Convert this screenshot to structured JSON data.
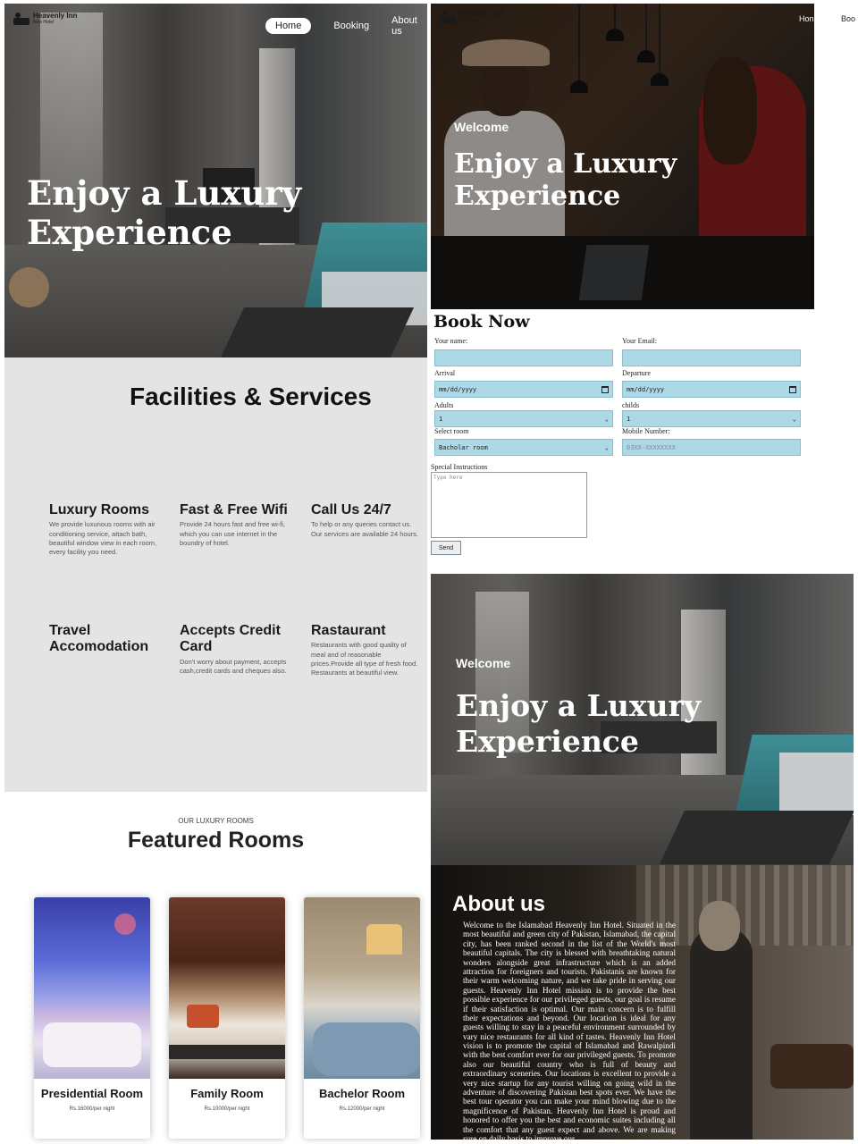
{
  "brand": {
    "name": "Heavenly Inn",
    "tagline": "Nice Hotel"
  },
  "nav": {
    "home": "Home",
    "booking": "Booking",
    "about": "About us"
  },
  "nav_right_clipped": {
    "home": "Hon",
    "booking": "Boo"
  },
  "hero": {
    "welcome": "Welcome",
    "title_line1": "Enjoy a Luxury",
    "title_line2": "Experience"
  },
  "facilities": {
    "title": "Facilities & Services",
    "items": [
      {
        "title": "Luxury Rooms",
        "text": "We provide luxurious rooms with air conditioning service, attach bath, beautiful window view in each room, every facility you need."
      },
      {
        "title": "Fast & Free Wifi",
        "text": "Provide 24 hours fast and free wi-fi, which you can use internet in the boundry of hotel."
      },
      {
        "title": "Call Us 24/7",
        "text": "To help or any queries contact us. Our services are available 24 hours."
      },
      {
        "title": "Travel Accomodation",
        "text": ""
      },
      {
        "title": "Accepts Credit Card",
        "text": "Don't worry about payment, accepts cash,credit cards and cheques also."
      },
      {
        "title": "Rastaurant",
        "text": "Restaurants with good quality of meal and of reasonable prices.Provide all type of fresh food. Restaurants at beautiful view."
      }
    ]
  },
  "featured": {
    "eyebrow": "OUR LUXURY ROOMS",
    "title": "Featured Rooms",
    "rooms": [
      {
        "name": "Presidential Room",
        "price": "Rs.16000/per night"
      },
      {
        "name": "Family Room",
        "price": "Rs.10000/per night"
      },
      {
        "name": "Bachelor Room",
        "price": "Rs.12000/per night"
      }
    ]
  },
  "booking": {
    "title": "Book Now",
    "name_label": "Your name:",
    "email_label": "Your Email:",
    "arrival_label": "Arrival",
    "arrival_value": "mm/dd/yyyy",
    "departure_label": "Departure",
    "departure_value": "mm/dd/yyyy",
    "adults_label": "Adults",
    "adults_value": "1",
    "childs_label": "childs",
    "childs_value": "1",
    "room_label": "Select room",
    "room_value": "Bacholar room",
    "mobile_label": "Mobile Number:",
    "mobile_placeholder": "03XX-XXXXXXXX",
    "instructions_label": "Special Instructions",
    "instructions_placeholder": "Type here",
    "send_label": "Send"
  },
  "about": {
    "title": "About us",
    "text": "Welcome to the Islamabad Heavenly Inn Hotel. Situated in the most beautiful and green city of Pakistan, Islamabad, the capital city, has been ranked second in the list of the World's most beautiful capitals. The city is blessed with breathtaking natural wonders alongside great infrastructure which is an added attraction for foreigners and tourists. Pakistanis are known for their warm welcoming nature, and we take pride in serving our guests. Heavenly Inn Hotel mission is to provide the best possible experience for our privileged guests, our goal is resume if their satisfaction is optimal. Our main concern is to fulfill their expectations and beyond. Our location is ideal for any guests willing to stay in a peaceful environment surrounded by vary nice restaurants for all kind of tastes. Heavenly Inn Hotel vision is to promote the capital of Islamabad and Rawalpindi with the best comfort ever for our privileged guests. To promote also our beautiful country who is full of beauty and extraordinary sceneries. Our locations is excellent to provide a very nice startup for any tourist willing on going wild in the adventure of discovering Pakistan best spots ever. We have the best tour operator you can make your mind blowing due to the magnificence of Pakistan. Heavenly Inn Hotel is proud and honored to offer you the best and economic suites including all the comfort that any guest expect and above. We are making sure on daily basis to improve our"
  },
  "colors": {
    "field_bg": "#add8e6",
    "facilities_bg": "#e4e4e4",
    "nav_active_bg": "#ffffff"
  },
  "icons": [
    "bed-logo-icon",
    "calendar-icon",
    "dropdown-caret-icon"
  ]
}
